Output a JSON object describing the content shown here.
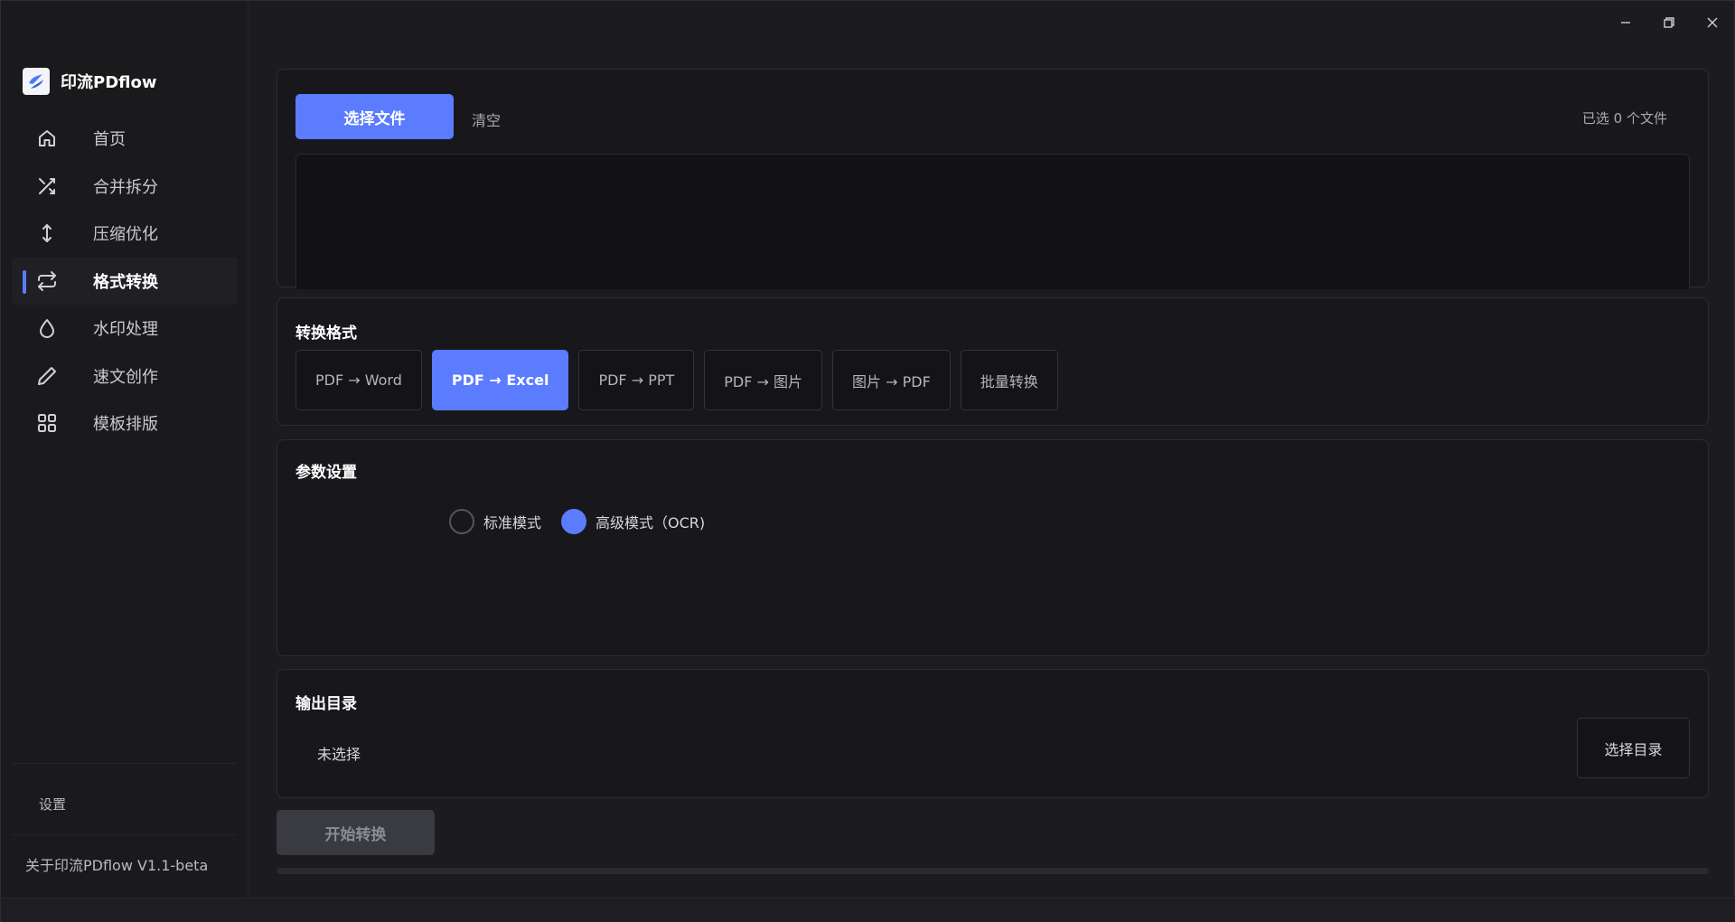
{
  "app": {
    "name": "印流PDflow"
  },
  "sidebar": {
    "items": [
      {
        "label": "首页",
        "icon": "home-icon",
        "active": false
      },
      {
        "label": "合并拆分",
        "icon": "shuffle-icon",
        "active": false
      },
      {
        "label": "压缩优化",
        "icon": "arrows-vertical-icon",
        "active": false
      },
      {
        "label": "格式转换",
        "icon": "repeat-icon",
        "active": true
      },
      {
        "label": "水印处理",
        "icon": "droplet-icon",
        "active": false
      },
      {
        "label": "速文创作",
        "icon": "pen-icon",
        "active": false
      },
      {
        "label": "模板排版",
        "icon": "grid-icon",
        "active": false
      }
    ],
    "settings_label": "设置",
    "about_label": "关于印流PDflow  V1.1-beta"
  },
  "files": {
    "select_label": "选择文件",
    "clear_label": "清空",
    "count_text": "已选 0 个文件"
  },
  "format": {
    "title": "转换格式",
    "options": [
      {
        "label": "PDF → Word",
        "active": false
      },
      {
        "label": "PDF → Excel",
        "active": true
      },
      {
        "label": "PDF → PPT",
        "active": false
      },
      {
        "label": "PDF → 图片",
        "active": false
      },
      {
        "label": "图片 → PDF",
        "active": false
      },
      {
        "label": "批量转换",
        "active": false
      }
    ]
  },
  "params": {
    "title": "参数设置",
    "modes": [
      {
        "label": "标准模式",
        "checked": false
      },
      {
        "label": "高级模式（OCR)",
        "checked": true
      }
    ]
  },
  "output": {
    "title": "输出目录",
    "value": "未选择",
    "choose_label": "选择目录"
  },
  "actions": {
    "start_label": "开始转换",
    "progress": 0
  },
  "colors": {
    "accent": "#5b7cff",
    "background": "#1c1c20",
    "card": "#18181c"
  }
}
